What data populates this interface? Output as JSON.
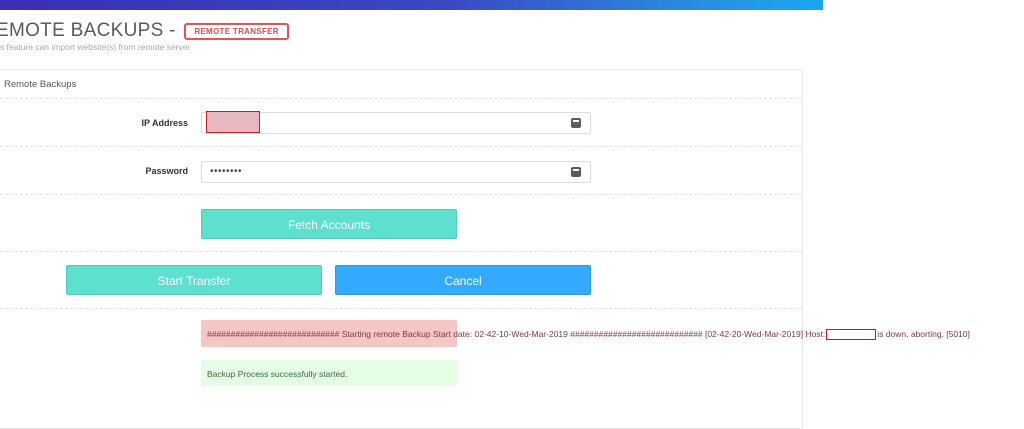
{
  "page": {
    "title": "EMOTE BACKUPS -",
    "badge": "REMOTE TRANSFER",
    "subtitle": "is feature can import website(s) from remote server"
  },
  "card": {
    "header": "Remote Backups"
  },
  "form": {
    "ip_label": "IP Address",
    "ip_value": "",
    "password_label": "Password",
    "password_value": "••••••••"
  },
  "buttons": {
    "fetch": "Fetch Accounts",
    "start": "Start Transfer",
    "cancel": "Cancel"
  },
  "log": {
    "part1": "############################ Starting remote Backup Start date: 02-42-10-Wed-Mar-2019 ############################ [02-42-20-Wed-Mar-2019] Host:",
    "part2": "is down, aborting. [5010]"
  },
  "status": {
    "success": "Backup Process successfully started."
  },
  "colors": {
    "accent_teal": "#5ee0cf",
    "accent_blue": "#33aaff",
    "danger_bg": "#f6c6c6",
    "success_bg": "#e4fde4"
  }
}
